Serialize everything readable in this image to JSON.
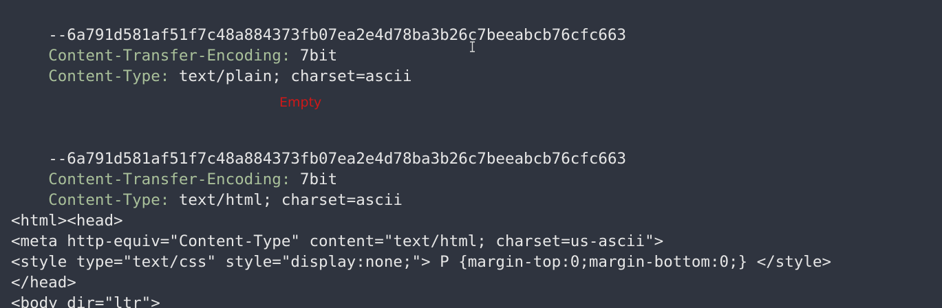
{
  "part1": {
    "boundary": "--6a791d581af51f7c48a884373fb07ea2e4d78ba3b26c7beeabcb76cfc663",
    "headers": [
      {
        "name": "Content-Transfer-Encoding:",
        "value": " 7bit"
      },
      {
        "name": "Content-Type:",
        "value": " text/plain; charset=ascii"
      }
    ],
    "body_placeholder": "Empty"
  },
  "part2": {
    "boundary": "--6a791d581af51f7c48a884373fb07ea2e4d78ba3b26c7beeabcb76cfc663",
    "headers": [
      {
        "name": "Content-Transfer-Encoding:",
        "value": " 7bit"
      },
      {
        "name": "Content-Type:",
        "value": " text/html; charset=ascii"
      }
    ],
    "body_lines": [
      "<html><head>",
      "<meta http-equiv=\"Content-Type\" content=\"text/html; charset=us-ascii\">",
      "<style type=\"text/css\" style=\"display:none;\"> P {margin-top:0;margin-bottom:0;} </style>",
      "</head>",
      "<body dir=\"ltr\">"
    ]
  },
  "colors": {
    "background": "#2f343f",
    "header_name": "#a9c09a",
    "text": "#e6e6e6",
    "empty_label": "#d01818"
  },
  "icons": {
    "cursor": "text-cursor-icon"
  }
}
